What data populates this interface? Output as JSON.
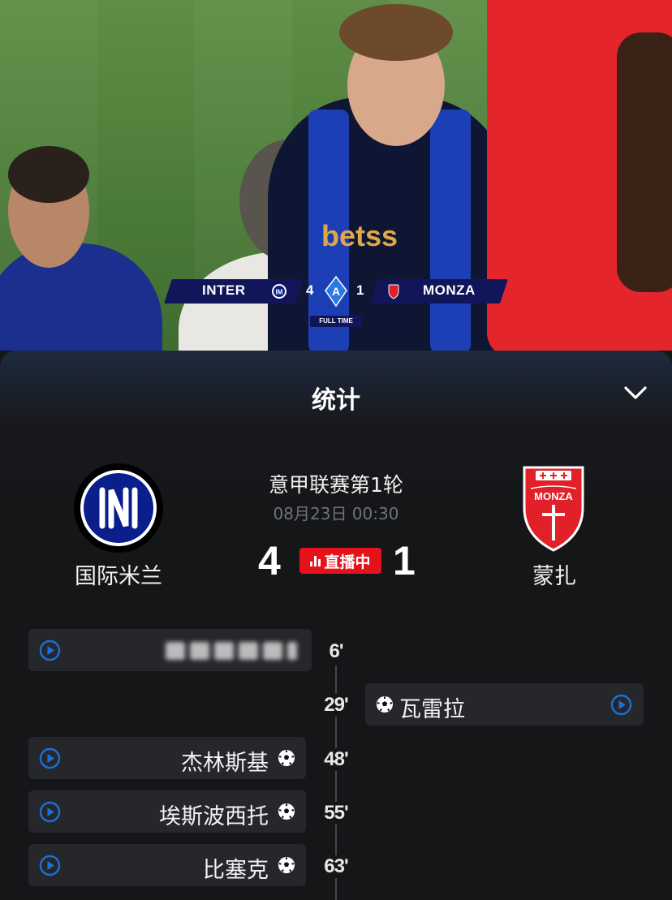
{
  "video": {
    "scoreboard": {
      "home_team": "INTER",
      "home_score": "4",
      "away_score": "1",
      "away_team": "MONZA",
      "status": "FULL TIME"
    },
    "sponsor": "betss"
  },
  "panel": {
    "title": "统计",
    "collapse_icon": "chevron-down-icon"
  },
  "match": {
    "league_round": "意甲联赛第1轮",
    "datetime": "08月23日 00:30",
    "home_team": "国际米兰",
    "away_team": "蒙扎",
    "home_score": "4",
    "away_score": "1",
    "live_label": "直播中",
    "live_color": "#e5121c"
  },
  "timeline": {
    "events": [
      {
        "side": "home",
        "minute": "6'",
        "player": "",
        "icon": "play-icon"
      },
      {
        "side": "away",
        "minute": "29'",
        "player": "瓦雷拉",
        "icon": "soccer-ball-icon"
      },
      {
        "side": "home",
        "minute": "48'",
        "player": "杰林斯基",
        "icon": "soccer-ball-icon"
      },
      {
        "side": "home",
        "minute": "55'",
        "player": "埃斯波西托",
        "icon": "soccer-ball-icon"
      },
      {
        "side": "home",
        "minute": "63'",
        "player": "比塞克",
        "icon": "soccer-ball-icon"
      }
    ]
  },
  "colors": {
    "background": "#151618",
    "card": "#25272b",
    "accent_blue": "#1b6fd6",
    "inter_blue": "#0a1e8c",
    "monza_red": "#e2202a"
  }
}
